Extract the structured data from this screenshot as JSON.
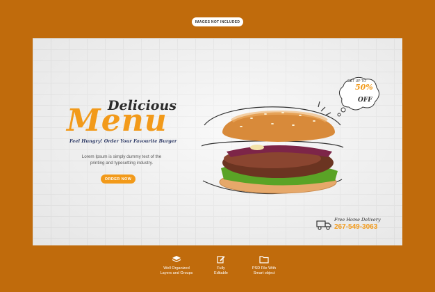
{
  "badge": {
    "text": "IMAGES NOT INCLUDED"
  },
  "banner": {
    "headline_small": "Delicious",
    "headline_large": "Menu",
    "tagline": "Feel Hungry! Order Your Favourite Burger",
    "description_line1": "Lorem Ipsum is simply dummy text of the",
    "description_line2": "printing and typesetting industry.",
    "order_button": "ORDER NOW",
    "offer": {
      "small": "GET UP TO",
      "percent": "50%",
      "off": "OFF"
    },
    "delivery": {
      "label": "Free Home Delivery",
      "phone": "267-549-3063"
    }
  },
  "features": [
    {
      "line1": "Well Organized",
      "line2": "Layers and Groups",
      "icon": "layers-icon"
    },
    {
      "line1": "Fully",
      "line2": "Editable",
      "icon": "edit-icon"
    },
    {
      "line1": "PSD File With",
      "line2": "Smart object",
      "icon": "folder-icon"
    }
  ],
  "colors": {
    "background": "#c06b0c",
    "accent": "#f29a1a",
    "dark_text": "#2b2b2b",
    "tagline": "#2e3a66"
  }
}
